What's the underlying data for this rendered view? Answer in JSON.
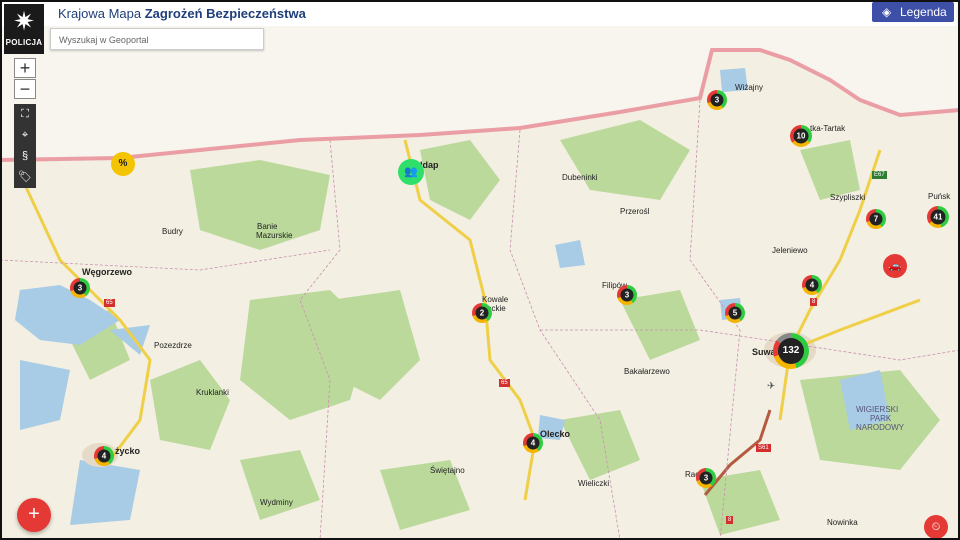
{
  "header": {
    "title_prefix": "Krajowa Mapa",
    "title_main": "Zagrożeń Bezpieczeństwa",
    "logo_label": "POLICJA",
    "legend_label": "Legenda",
    "search_placeholder": "Wyszukaj w Geoportal"
  },
  "controls": {
    "zoom_in": "+",
    "zoom_out": "−",
    "fullscreen_icon": "⛶",
    "locate_icon": "⌖",
    "paragraph_icon": "§",
    "tags_icon": "🏷",
    "add_label": "+"
  },
  "map": {
    "colors": {
      "forest": "#b9d99a",
      "water": "#a9cbe8",
      "road": "#f2d24a",
      "border": "#e8939a",
      "urban": "#e6dccb"
    },
    "towns": [
      {
        "id": "wiziny",
        "name": "Wiżajny"
      },
      {
        "id": "rutka",
        "name": "tka-Tartak"
      },
      {
        "id": "punsk",
        "name": "Puńsk"
      },
      {
        "id": "szypliszki",
        "name": "Szypliszki"
      },
      {
        "id": "jeleniewo",
        "name": "Jeleniewo"
      },
      {
        "id": "suwalki",
        "name": "Suwa"
      },
      {
        "id": "dubeninki",
        "name": "Dubeninki"
      },
      {
        "id": "przerosl",
        "name": "Przerośl"
      },
      {
        "id": "filipow",
        "name": "Filipów"
      },
      {
        "id": "bakalarzewo",
        "name": "Bakałarzewo"
      },
      {
        "id": "budry",
        "name": "Budry"
      },
      {
        "id": "banie1",
        "name": "Banie"
      },
      {
        "id": "banie2",
        "name": "Mazurskie"
      },
      {
        "id": "wegorzewo",
        "name": "Węgorzewo"
      },
      {
        "id": "pozezdrze",
        "name": "Pozezdrze"
      },
      {
        "id": "kruklanki",
        "name": "Kruklanki"
      },
      {
        "id": "kowale1",
        "name": "Kowale"
      },
      {
        "id": "kowale2",
        "name": "eckie"
      },
      {
        "id": "olecko",
        "name": "Olecko"
      },
      {
        "id": "swietajno",
        "name": "Świętajno"
      },
      {
        "id": "wieliczki",
        "name": "Wieliczki"
      },
      {
        "id": "wydminy",
        "name": "Wydminy"
      },
      {
        "id": "gizycko",
        "name": "życko"
      },
      {
        "id": "raczki",
        "name": "Rac"
      },
      {
        "id": "nowinka",
        "name": "Nowinka"
      },
      {
        "id": "goldap",
        "name": "łdap"
      },
      {
        "id": "wpn1",
        "name": "WIGIERSKI"
      },
      {
        "id": "wpn2",
        "name": "PARK"
      },
      {
        "id": "wpn3",
        "name": "NARODOWY"
      }
    ],
    "road_signs": [
      "E67",
      "65",
      "65",
      "S61",
      "8",
      "8"
    ],
    "clusters": [
      {
        "id": "c1",
        "count": "3"
      },
      {
        "id": "c2",
        "count": "10"
      },
      {
        "id": "c3",
        "count": "7"
      },
      {
        "id": "c4",
        "count": "41"
      },
      {
        "id": "c5",
        "count": "4"
      },
      {
        "id": "c6",
        "count": "5"
      },
      {
        "id": "c7",
        "count": "132"
      },
      {
        "id": "c8",
        "count": "3"
      },
      {
        "id": "c9",
        "count": "2"
      },
      {
        "id": "c10",
        "count": "3"
      },
      {
        "id": "c11",
        "count": "4"
      },
      {
        "id": "c12",
        "count": "4"
      },
      {
        "id": "c13",
        "count": "3"
      }
    ],
    "threat_icons": [
      {
        "id": "alcohol",
        "label": "%",
        "icon": "bottle-icon"
      },
      {
        "id": "people",
        "label": "👥",
        "icon": "people-icon"
      },
      {
        "id": "car",
        "label": "🚗",
        "icon": "car-accident-icon"
      },
      {
        "id": "speed",
        "label": "⏲",
        "icon": "speed-icon"
      }
    ]
  }
}
